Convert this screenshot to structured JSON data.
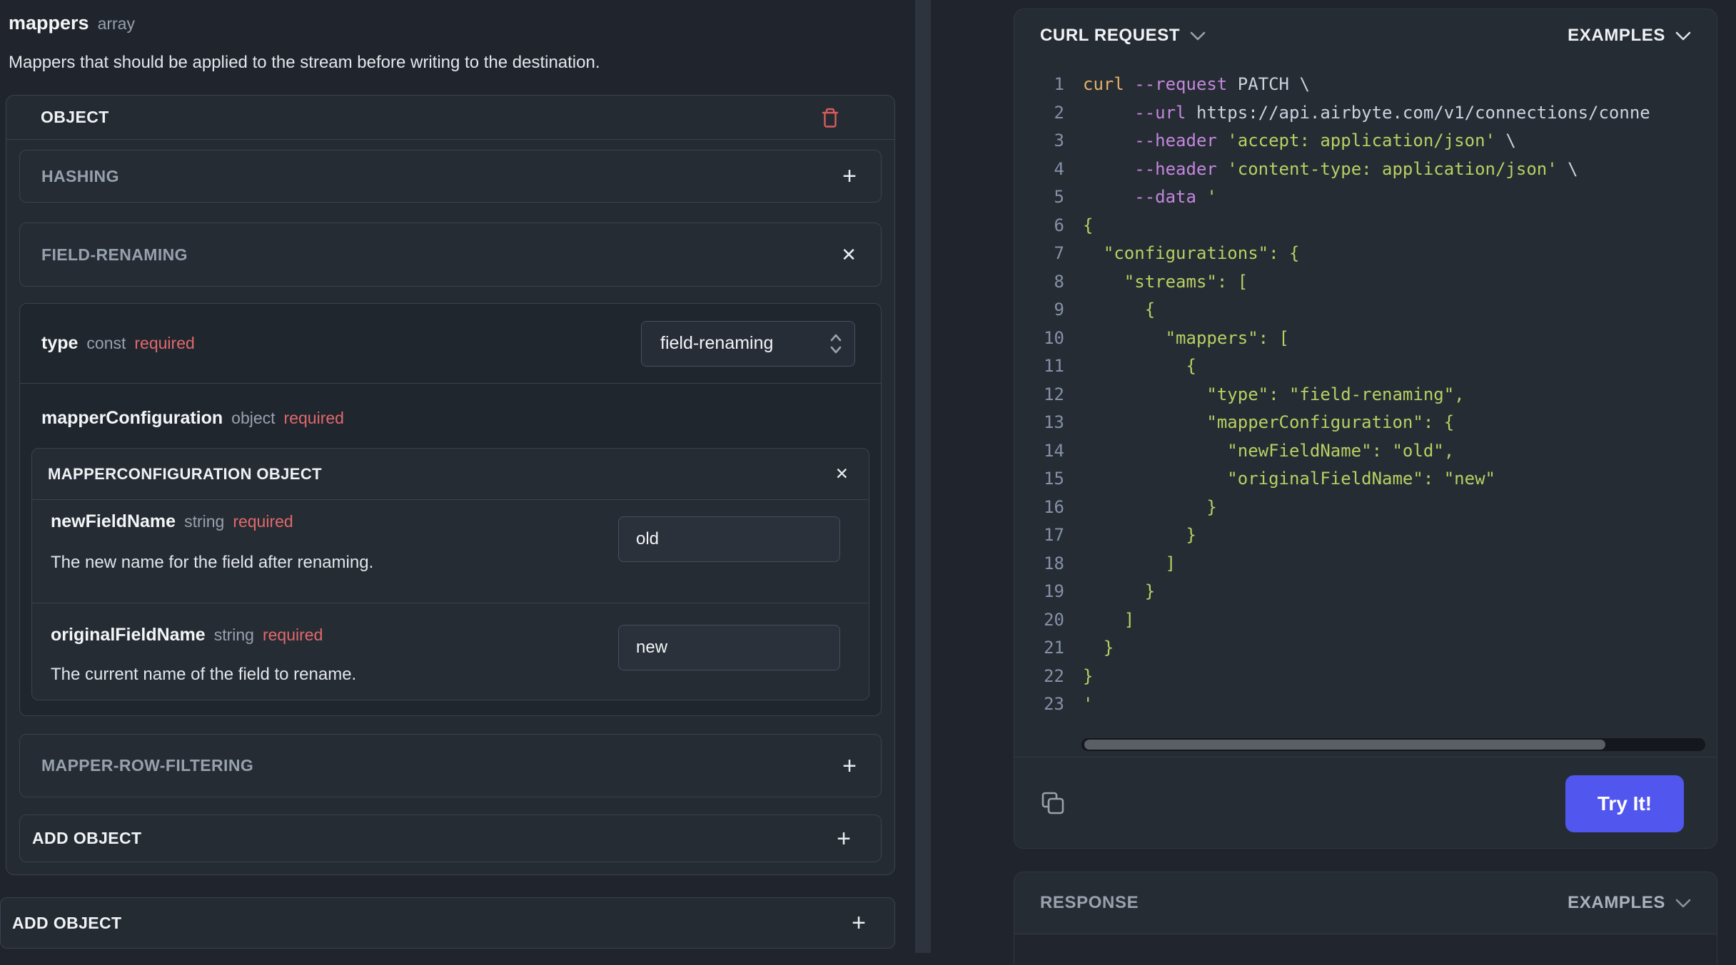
{
  "colors": {
    "accent_blue": "#5157ee",
    "required_red": "#e0696b",
    "trash_red": "#d95c5c",
    "code_orange": "#e3b168",
    "code_purple": "#c387dd",
    "code_green": "#b9cf62"
  },
  "left_panel": {
    "field": {
      "name": "mappers",
      "type": "array",
      "description": "Mappers that should be applied to the stream before writing to the destination."
    },
    "object_item": {
      "title": "OBJECT",
      "hashing": {
        "label": "HASHING"
      },
      "field_renaming": {
        "label": "FIELD-RENAMING",
        "type_field": {
          "name": "type",
          "kind": "const",
          "required": "required",
          "value": "field-renaming"
        },
        "mapper_configuration": {
          "name": "mapperConfiguration",
          "kind": "object",
          "required": "required",
          "panel_title": "MAPPERCONFIGURATION OBJECT",
          "fields": [
            {
              "name": "newFieldName",
              "kind": "string",
              "required": "required",
              "description": "The new name for the field after renaming.",
              "value": "old"
            },
            {
              "name": "originalFieldName",
              "kind": "string",
              "required": "required",
              "description": "The current name of the field to rename.",
              "value": "new"
            }
          ]
        }
      },
      "mapper_row_filtering": {
        "label": "MAPPER-ROW-FILTERING"
      },
      "add_object_label": "ADD OBJECT"
    },
    "outer_add_object_label": "ADD OBJECT"
  },
  "right_panel": {
    "curl_card": {
      "title": "CURL REQUEST",
      "examples_label": "EXAMPLES",
      "try_it_label": "Try It!",
      "code_lines": [
        {
          "num": "1",
          "segments": [
            [
              "cmd",
              "curl"
            ],
            [
              "plain",
              " "
            ],
            [
              "flag",
              "--request"
            ],
            [
              "plain",
              " PATCH \\"
            ]
          ]
        },
        {
          "num": "2",
          "segments": [
            [
              "plain",
              "     "
            ],
            [
              "flag",
              "--url"
            ],
            [
              "plain",
              " https://api.airbyte.com/v1/connections/conne"
            ]
          ]
        },
        {
          "num": "3",
          "segments": [
            [
              "plain",
              "     "
            ],
            [
              "flag",
              "--header"
            ],
            [
              "plain",
              " "
            ],
            [
              "str",
              "'accept: application/json'"
            ],
            [
              "plain",
              " \\"
            ]
          ]
        },
        {
          "num": "4",
          "segments": [
            [
              "plain",
              "     "
            ],
            [
              "flag",
              "--header"
            ],
            [
              "plain",
              " "
            ],
            [
              "str",
              "'content-type: application/json'"
            ],
            [
              "plain",
              " \\"
            ]
          ]
        },
        {
          "num": "5",
          "segments": [
            [
              "plain",
              "     "
            ],
            [
              "flag",
              "--data"
            ],
            [
              "plain",
              " "
            ],
            [
              "str",
              "'"
            ]
          ]
        },
        {
          "num": "6",
          "segments": [
            [
              "json",
              "{"
            ]
          ]
        },
        {
          "num": "7",
          "segments": [
            [
              "json",
              "  \"configurations\": {"
            ]
          ]
        },
        {
          "num": "8",
          "segments": [
            [
              "json",
              "    \"streams\": ["
            ]
          ]
        },
        {
          "num": "9",
          "segments": [
            [
              "json",
              "      {"
            ]
          ]
        },
        {
          "num": "10",
          "segments": [
            [
              "json",
              "        \"mappers\": ["
            ]
          ]
        },
        {
          "num": "11",
          "segments": [
            [
              "json",
              "          {"
            ]
          ]
        },
        {
          "num": "12",
          "segments": [
            [
              "json",
              "            \"type\": \"field-renaming\","
            ]
          ]
        },
        {
          "num": "13",
          "segments": [
            [
              "json",
              "            \"mapperConfiguration\": {"
            ]
          ]
        },
        {
          "num": "14",
          "segments": [
            [
              "json",
              "              \"newFieldName\": \"old\","
            ]
          ]
        },
        {
          "num": "15",
          "segments": [
            [
              "json",
              "              \"originalFieldName\": \"new\""
            ]
          ]
        },
        {
          "num": "16",
          "segments": [
            [
              "json",
              "            }"
            ]
          ]
        },
        {
          "num": "17",
          "segments": [
            [
              "json",
              "          }"
            ]
          ]
        },
        {
          "num": "18",
          "segments": [
            [
              "json",
              "        ]"
            ]
          ]
        },
        {
          "num": "19",
          "segments": [
            [
              "json",
              "      }"
            ]
          ]
        },
        {
          "num": "20",
          "segments": [
            [
              "json",
              "    ]"
            ]
          ]
        },
        {
          "num": "21",
          "segments": [
            [
              "json",
              "  }"
            ]
          ]
        },
        {
          "num": "22",
          "segments": [
            [
              "json",
              "}"
            ]
          ]
        },
        {
          "num": "23",
          "segments": [
            [
              "json",
              "'"
            ]
          ]
        }
      ]
    },
    "response_card": {
      "title": "RESPONSE",
      "examples_label": "EXAMPLES"
    }
  }
}
